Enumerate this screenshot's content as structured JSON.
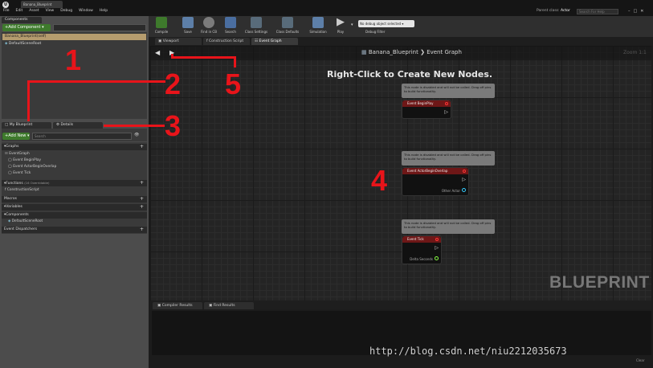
{
  "menu": {
    "items": [
      "File",
      "Edit",
      "Asset",
      "View",
      "Debug",
      "Window",
      "Help"
    ],
    "parent_class_label": "Parent class:",
    "parent_class_value": "Actor",
    "search_placeholder": "Search For Help"
  },
  "doc_tab": "Banana_Blueprint",
  "components": {
    "tab": "Components",
    "add_button": "+Add Component ▾",
    "items": [
      "Banana_Blueprint(self)",
      "DefaultSceneRoot"
    ]
  },
  "my_blueprint": {
    "tab": "My Blueprint",
    "details_tab": "Details",
    "add_new": "+Add New ▾",
    "search_placeholder": "Search",
    "sections": {
      "graphs": "Graphs",
      "event_graph": "EventGraph",
      "events": [
        "Event BeginPlay",
        "Event ActorBeginOverlap",
        "Event Tick"
      ],
      "functions": "Functions",
      "functions_note": "(16 Overridable)",
      "construction_script": "ConstructionScript",
      "macros": "Macros",
      "variables": "Variables",
      "components": "Components",
      "default_scene_root": "DefaultSceneRoot",
      "event_dispatchers": "Event Dispatchers"
    }
  },
  "toolbar": {
    "buttons": [
      "Compile",
      "Save",
      "Find in CB",
      "Search",
      "Class Settings",
      "Class Defaults",
      "Simulation",
      "Play"
    ],
    "debug_dropdown": "No debug object selected ▾",
    "debug_filter": "Debug Filter"
  },
  "editor_tabs": [
    "Viewport",
    "Construction Script",
    "Event Graph"
  ],
  "graph": {
    "breadcrumb_bp": "Banana_Blueprint",
    "breadcrumb_sep": "❯",
    "breadcrumb_graph": "Event Graph",
    "zoom": "Zoom 1:1",
    "hint": "Right-Click to Create New Nodes.",
    "watermark": "BLUEPRINT",
    "comment_text": "This node is disabled and will not be called. Drag off pins to build functionality.",
    "nodes": [
      {
        "title": "Event BeginPlay",
        "output": ""
      },
      {
        "title": "Event ActorBeginOverlap",
        "output": "Other Actor"
      },
      {
        "title": "Event Tick",
        "output": "Delta Seconds"
      }
    ]
  },
  "results": {
    "tabs": [
      "Compiler Results",
      "Find Results"
    ],
    "clear": "Clear"
  },
  "annotations": [
    "1",
    "2",
    "3",
    "4",
    "5"
  ],
  "watermark_url": "http://blog.csdn.net/niu2212035673",
  "colors": {
    "accent_green": "#3e7a2c",
    "event_red": "#6e1717",
    "annotation_red": "#e8141a",
    "selected_row": "#b59c6e"
  }
}
